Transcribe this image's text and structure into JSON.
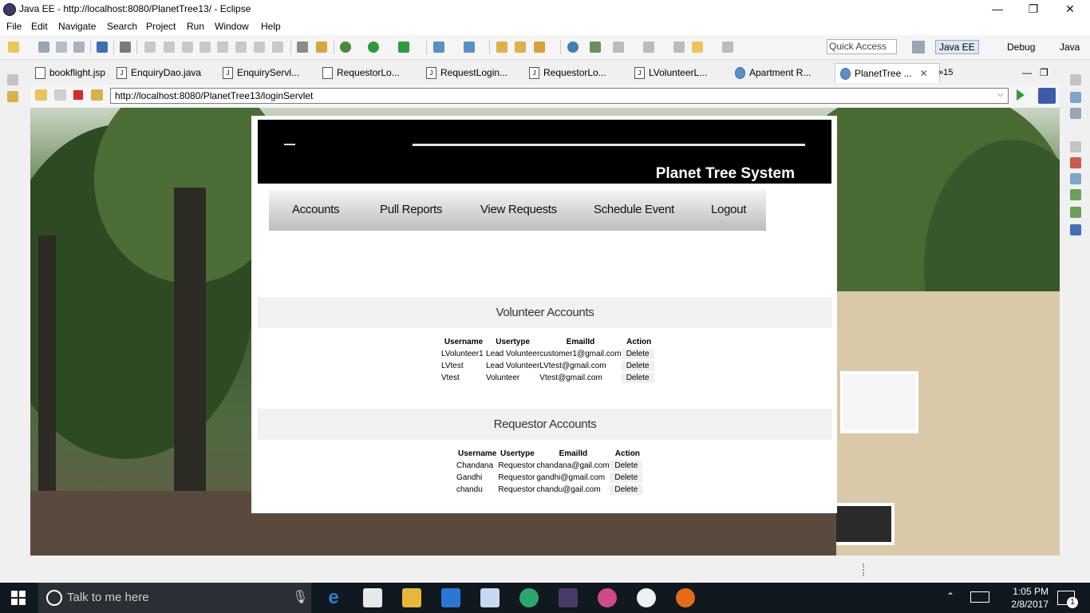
{
  "window": {
    "title": "Java EE - http://localhost:8080/PlanetTree13/ - Eclipse",
    "controls": {
      "minimize": "—",
      "restore": "❐",
      "close": "✕"
    }
  },
  "menubar": [
    "File",
    "Edit",
    "Navigate",
    "Search",
    "Project",
    "Run",
    "Window",
    "Help"
  ],
  "toolbar": {
    "quick_access_placeholder": "Quick Access",
    "perspectives": [
      "Java EE",
      "Debug",
      "Java"
    ]
  },
  "editor_tabs": [
    "bookflight.jsp",
    "EnquiryDao.java",
    "EnquiryServl...",
    "RequestorLo...",
    "RequestLogin...",
    "RequestorLo...",
    "LVolunteerL...",
    "Apartment R...",
    "PlanetTree ...",
    "»15"
  ],
  "browser": {
    "url": "http://localhost:8080/PlanetTree13/loginServlet"
  },
  "site": {
    "title": "Planet Tree System",
    "nav": [
      "Accounts",
      "Pull Reports",
      "View Requests",
      "Schedule Event",
      "Logout"
    ],
    "volunteer_section": {
      "heading": "Volunteer Accounts",
      "columns": [
        "Username",
        "Usertype",
        "EmailId",
        "Action"
      ],
      "rows": [
        [
          "LVolunteer1",
          "Lead Volunteer",
          "customer1@gmail.com",
          "Delete"
        ],
        [
          "LVtest",
          "Lead Volunteer",
          "LVtest@gmail.com",
          "Delete"
        ],
        [
          "Vtest",
          "Volunteer",
          "Vtest@gmail.com",
          "Delete"
        ]
      ]
    },
    "requestor_section": {
      "heading": "Requestor Accounts",
      "columns": [
        "Username",
        "Usertype",
        "EmailId",
        "Action"
      ],
      "rows": [
        [
          "Chandana",
          "Requestor",
          "chandana@gail.com",
          "Delete"
        ],
        [
          "Gandhi",
          "Requestor",
          "gandhi@gmail.com",
          "Delete"
        ],
        [
          "chandu",
          "Requestor",
          "chandu@gail.com",
          "Delete"
        ]
      ]
    }
  },
  "taskbar": {
    "search_placeholder": "Talk to me here",
    "time": "1:05 PM",
    "date": "2/8/2017",
    "notification_count": "1"
  }
}
